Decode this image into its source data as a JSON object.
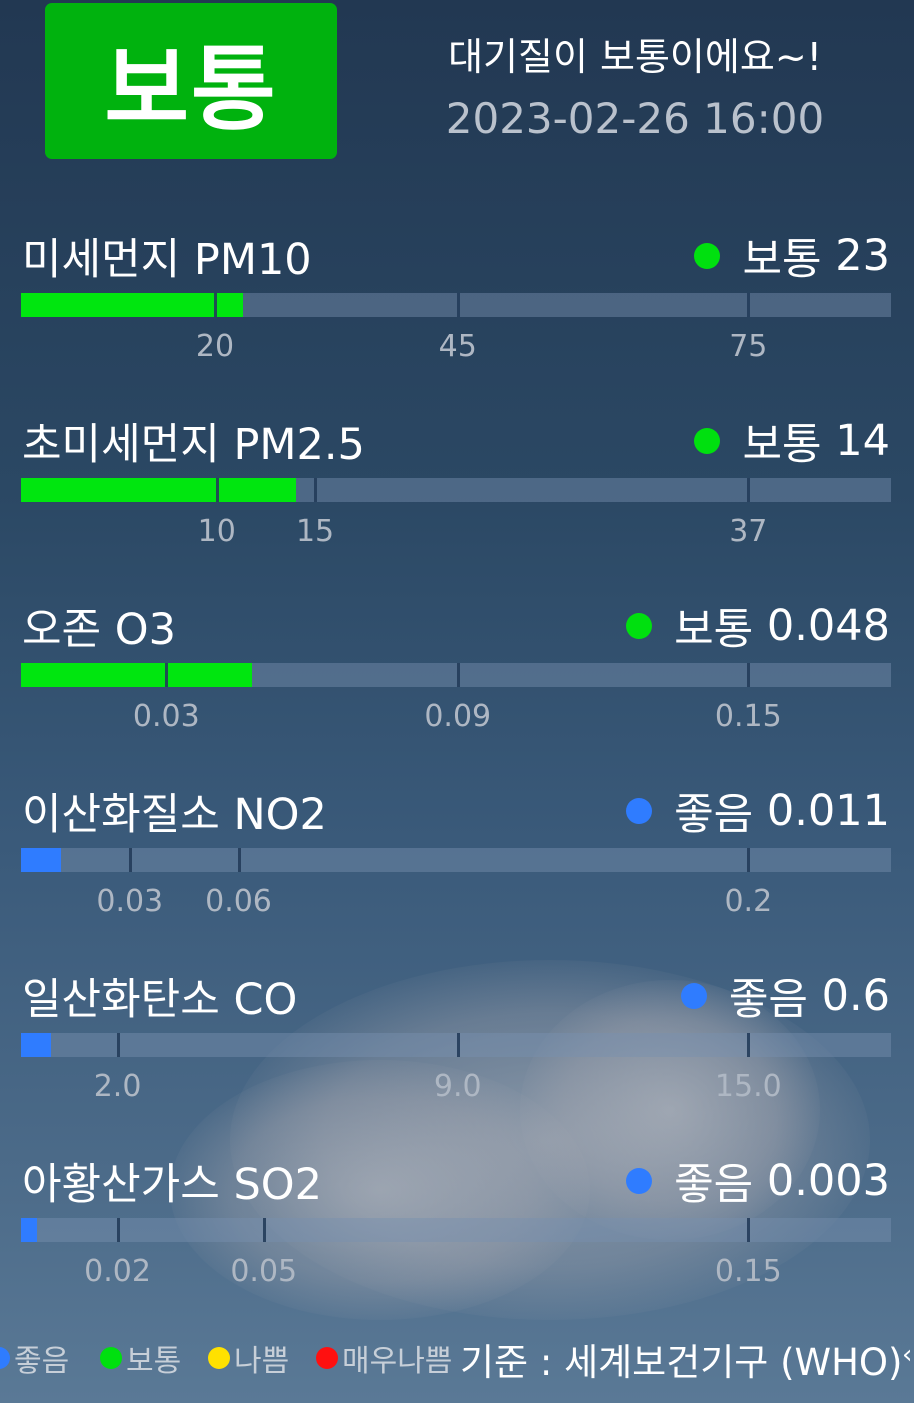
{
  "header": {
    "status_label": "보통",
    "status_color": "#00b20e",
    "headline": "대기질이 보통이에요~!",
    "datetime": "2023-02-26 16:00"
  },
  "pollutants": [
    {
      "name": "미세먼지 PM10",
      "status": "보통",
      "value": "23",
      "color": "#00e60f",
      "dot_color": "#00e00f",
      "fill_fraction": 0.255,
      "ticks": [
        "20",
        "45",
        "75"
      ]
    },
    {
      "name": "초미세먼지 PM2.5",
      "status": "보통",
      "value": "14",
      "color": "#00e60f",
      "dot_color": "#00e00f",
      "fill_fraction": 0.316,
      "ticks": [
        "10",
        "15",
        "37"
      ]
    },
    {
      "name": "오존 O3",
      "status": "보통",
      "value": "0.048",
      "color": "#00e60f",
      "dot_color": "#00e00f",
      "fill_fraction": 0.266,
      "ticks": [
        "0.03",
        "0.09",
        "0.15"
      ]
    },
    {
      "name": "이산화질소 NO2",
      "status": "좋음",
      "value": "0.011",
      "color": "#2f7cff",
      "dot_color": "#2f7cff",
      "fill_fraction": 0.046,
      "ticks": [
        "0.03",
        "0.06",
        "0.2"
      ]
    },
    {
      "name": "일산화탄소 CO",
      "status": "좋음",
      "value": "0.6",
      "color": "#2f7cff",
      "dot_color": "#2f7cff",
      "fill_fraction": 0.034,
      "ticks": [
        "2.0",
        "9.0",
        "15.0"
      ]
    },
    {
      "name": "아황산가스 SO2",
      "status": "좋음",
      "value": "0.003",
      "color": "#2f7cff",
      "dot_color": "#2f7cff",
      "fill_fraction": 0.018,
      "ticks": [
        "0.02",
        "0.05",
        "0.15"
      ]
    }
  ],
  "legend": {
    "items": [
      {
        "label": "좋음",
        "color": "#2f7cff"
      },
      {
        "label": "보통",
        "color": "#00e00f"
      },
      {
        "label": "나쁨",
        "color": "#ffe100"
      },
      {
        "label": "매우나쁨",
        "color": "#ff1010"
      }
    ],
    "standard": "기준 : 세계보건기구 (WHO)"
  }
}
